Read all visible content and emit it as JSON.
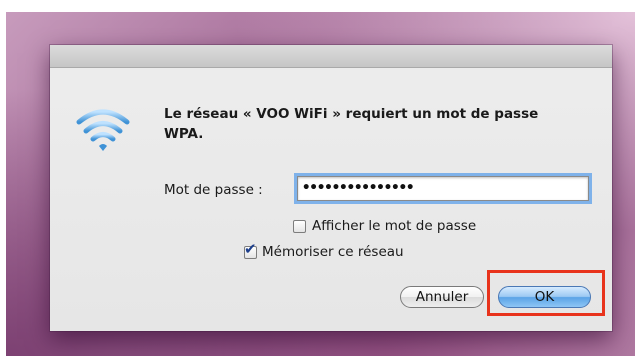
{
  "dialog": {
    "message": "Le réseau « VOO WiFi » requiert un mot de passe WPA.",
    "password_label": "Mot de passe :",
    "password_value": "•••••••••••••••",
    "show_password_label": "Afficher le mot de passe",
    "show_password_checked": false,
    "remember_label": "Mémoriser ce réseau",
    "remember_checked": true,
    "checkmark": "✔",
    "cancel_label": "Annuler",
    "ok_label": "OK",
    "icon": "wifi-icon"
  },
  "colors": {
    "highlight": "#e8331c",
    "focus_ring": "#7fb2ea",
    "default_button": "#5aa3e6"
  }
}
